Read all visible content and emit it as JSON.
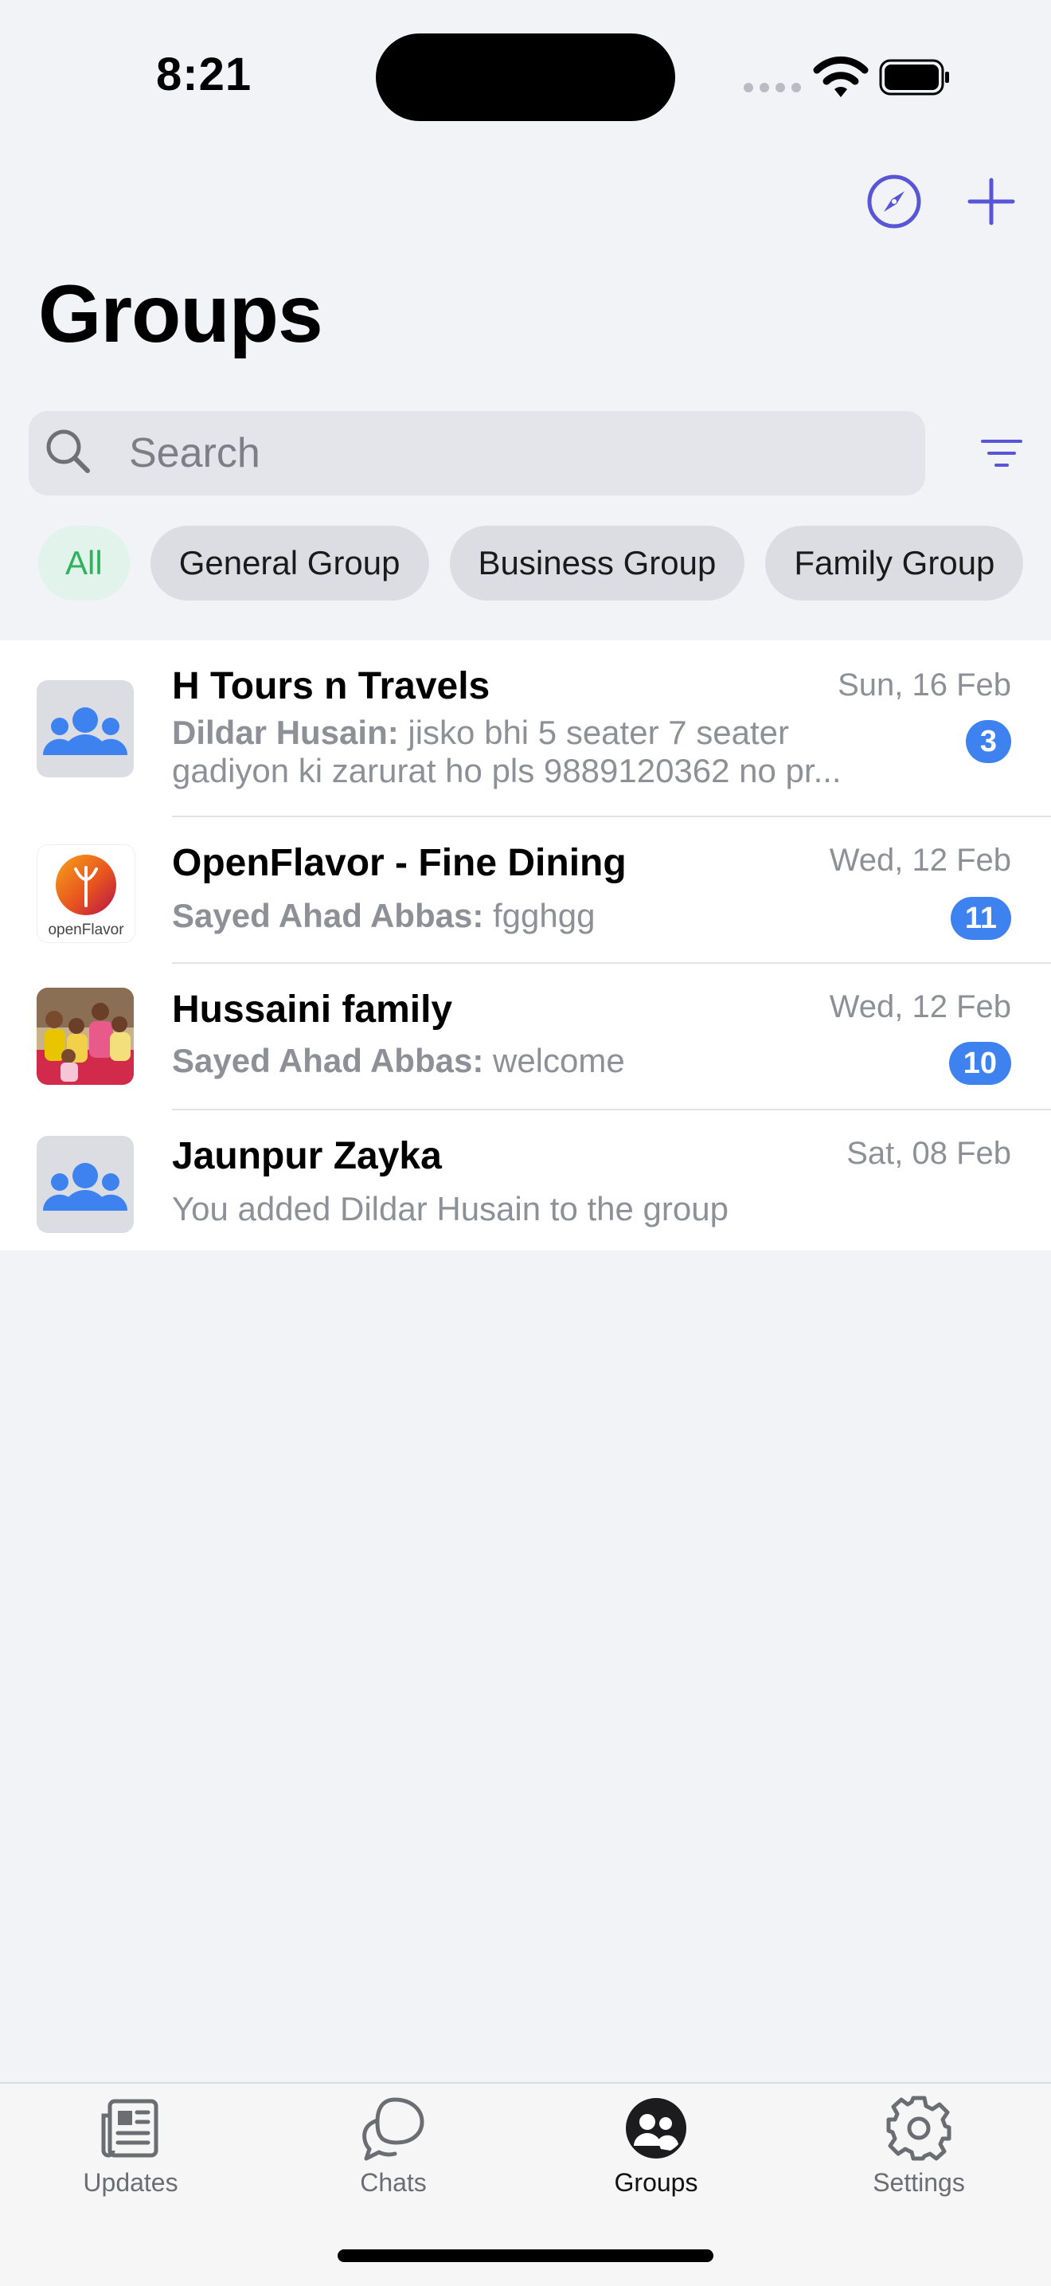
{
  "status_bar": {
    "time": "8:21"
  },
  "header": {
    "title": "Groups"
  },
  "search": {
    "placeholder": "Search"
  },
  "filters": {
    "chips": [
      "All",
      "General Group",
      "Business Group",
      "Family Group"
    ],
    "active": "All"
  },
  "groups": [
    {
      "name": "H Tours n Travels",
      "date": "Sun, 16 Feb",
      "sender": "Dildar Husain:",
      "message": "jisko bhi 5 seater 7 seater gadiyon ki zarurat ho pls 9889120362 no pr...",
      "unread": "3",
      "avatar": "group-placeholder-icon"
    },
    {
      "name": "OpenFlavor - Fine Dining",
      "date": "Wed, 12 Feb",
      "sender": "Sayed Ahad Abbas:",
      "message": "fgghgg",
      "unread": "11",
      "avatar": "openflavor-logo",
      "logo_text": "openFlavor"
    },
    {
      "name": "Hussaini family",
      "date": "Wed, 12 Feb",
      "sender": "Sayed Ahad Abbas:",
      "message": "welcome",
      "unread": "10",
      "avatar": "family-photo"
    },
    {
      "name": "Jaunpur Zayka",
      "date": "Sat, 08 Feb",
      "sender": "",
      "message": "You added Dildar Husain to the group",
      "unread": "",
      "avatar": "group-placeholder-icon"
    }
  ],
  "tabbar": {
    "tabs": [
      {
        "label": "Updates",
        "icon": "newspaper-icon"
      },
      {
        "label": "Chats",
        "icon": "chat-bubbles-icon"
      },
      {
        "label": "Groups",
        "icon": "groups-icon"
      },
      {
        "label": "Settings",
        "icon": "gear-icon"
      }
    ],
    "active": "Groups"
  },
  "colors": {
    "accent": "#5856d6",
    "badge": "#3e82f0",
    "chip_active_text": "#2db35e",
    "group_icon": "#3e82f0"
  }
}
